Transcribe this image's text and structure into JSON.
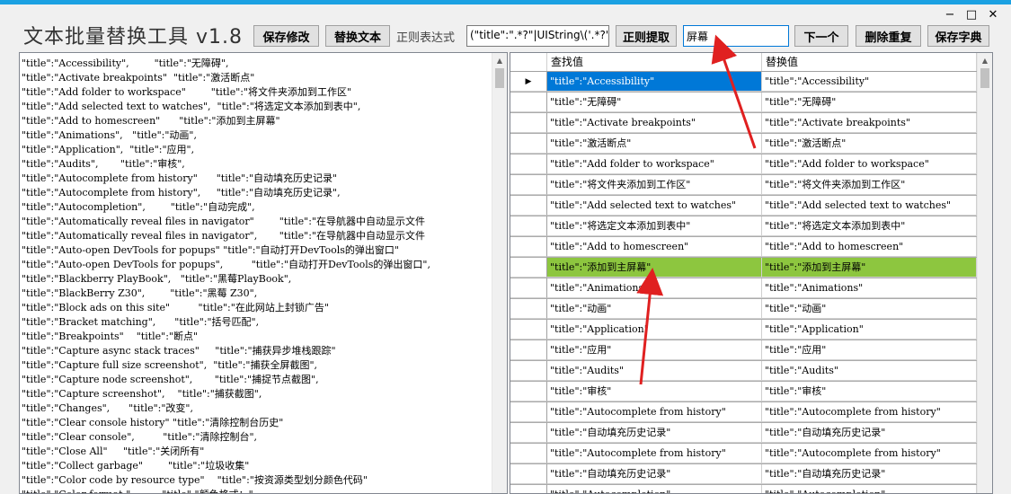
{
  "app": {
    "title": "文本批量替换工具 v1.8",
    "window_controls": [
      "−",
      "□",
      "✕"
    ]
  },
  "toolbar": {
    "save_changes_label": "保存修改",
    "replace_text_label": "替换文本",
    "regex_label": "正则表达式",
    "regex_value": "(\"title\":\".*?\"|UIString\\('.*?'\\))",
    "regex_extract_label": "正则提取",
    "search_value": "屏幕",
    "next_label": "下一个",
    "dedupe_label": "删除重复",
    "save_dict_label": "保存字典"
  },
  "left_lines": [
    "\"title\":\"Accessibility\",        \"title\":\"无障碍\",",
    "\"title\":\"Activate breakpoints\"  \"title\":\"激活断点\"",
    "\"title\":\"Add folder to workspace\"        \"title\":\"将文件夹添加到工作区\"",
    "\"title\":\"Add selected text to watches\",  \"title\":\"将选定文本添加到表中\",",
    "\"title\":\"Add to homescreen\"      \"title\":\"添加到主屏幕\"",
    "\"title\":\"Animations\",   \"title\":\"动画\",",
    "\"title\":\"Application\",  \"title\":\"应用\",",
    "\"title\":\"Audits\",       \"title\":\"审核\",",
    "\"title\":\"Autocomplete from history\"      \"title\":\"自动填充历史记录\"",
    "\"title\":\"Autocomplete from history\",     \"title\":\"自动填充历史记录\",",
    "\"title\":\"Autocompletion\",        \"title\":\"自动完成\",",
    "\"title\":\"Automatically reveal files in navigator\"        \"title\":\"在导航器中自动显示文件",
    "\"title\":\"Automatically reveal files in navigator\",       \"title\":\"在导航器中自动显示文件",
    "\"title\":\"Auto-open DevTools for popups\" \"title\":\"自动打开DevTools的弹出窗口\"",
    "\"title\":\"Auto-open DevTools for popups\",         \"title\":\"自动打开DevTools的弹出窗口\",",
    "\"title\":\"Blackberry PlayBook\",   \"title\":\"黑莓PlayBook\",",
    "\"title\":\"BlackBerry Z30\",        \"title\":\"黑莓 Z30\",",
    "\"title\":\"Block ads on this site\"         \"title\":\"在此网站上封锁广告\"",
    "\"title\":\"Bracket matching\",      \"title\":\"括号匹配\",",
    "\"title\":\"Breakpoints\"    \"title\":\"断点\"",
    "\"title\":\"Capture async stack traces\"     \"title\":\"捕获异步堆栈跟踪\"",
    "\"title\":\"Capture full size screenshot\",  \"title\":\"捕获全屏截图\",",
    "\"title\":\"Capture node screenshot\",       \"title\":\"捕捉节点截图\",",
    "\"title\":\"Capture screenshot\",    \"title\":\"捕获截图\",",
    "\"title\":\"Changes\",      \"title\":\"改变\",",
    "\"title\":\"Clear console history\" \"title\":\"清除控制台历史\"",
    "\"title\":\"Clear console\",         \"title\":\"清除控制台\",",
    "\"title\":\"Close All\"     \"title\":\"关闭所有\"",
    "\"title\":\"Collect garbage\"        \"title\":\"垃圾收集\"",
    "\"title\":\"Color code by resource type\"    \"title\":\"按资源类型划分颜色代码\"",
    "\"title\":\"Color format:\"          \"title\":\"颜色格式：\""
  ],
  "grid": {
    "col_find": "查找值",
    "col_replace": "替换值",
    "row_pointer": "▶",
    "rows": [
      {
        "find": "\"title\":\"Accessibility\"",
        "replace": "\"title\":\"Accessibility\""
      },
      {
        "find": "\"title\":\"无障碍\"",
        "replace": "\"title\":\"无障碍\""
      },
      {
        "find": "\"title\":\"Activate breakpoints\"",
        "replace": "\"title\":\"Activate breakpoints\""
      },
      {
        "find": "\"title\":\"激活断点\"",
        "replace": "\"title\":\"激活断点\""
      },
      {
        "find": "\"title\":\"Add folder to workspace\"",
        "replace": "\"title\":\"Add folder to workspace\""
      },
      {
        "find": "\"title\":\"将文件夹添加到工作区\"",
        "replace": "\"title\":\"将文件夹添加到工作区\""
      },
      {
        "find": "\"title\":\"Add selected text to watches\"",
        "replace": "\"title\":\"Add selected text to watches\""
      },
      {
        "find": "\"title\":\"将选定文本添加到表中\"",
        "replace": "\"title\":\"将选定文本添加到表中\""
      },
      {
        "find": "\"title\":\"Add to homescreen\"",
        "replace": "\"title\":\"Add to homescreen\""
      },
      {
        "find": "\"title\":\"添加到主屏幕\"",
        "replace": "\"title\":\"添加到主屏幕\""
      },
      {
        "find": "\"title\":\"Animations\"",
        "replace": "\"title\":\"Animations\""
      },
      {
        "find": "\"title\":\"动画\"",
        "replace": "\"title\":\"动画\""
      },
      {
        "find": "\"title\":\"Application\"",
        "replace": "\"title\":\"Application\""
      },
      {
        "find": "\"title\":\"应用\"",
        "replace": "\"title\":\"应用\""
      },
      {
        "find": "\"title\":\"Audits\"",
        "replace": "\"title\":\"Audits\""
      },
      {
        "find": "\"title\":\"审核\"",
        "replace": "\"title\":\"审核\""
      },
      {
        "find": "\"title\":\"Autocomplete from history\"",
        "replace": "\"title\":\"Autocomplete from history\""
      },
      {
        "find": "\"title\":\"自动填充历史记录\"",
        "replace": "\"title\":\"自动填充历史记录\""
      },
      {
        "find": "\"title\":\"Autocomplete from history\"",
        "replace": "\"title\":\"Autocomplete from history\""
      },
      {
        "find": "\"title\":\"自动填充历史记录\"",
        "replace": "\"title\":\"自动填充历史记录\""
      },
      {
        "find": "\"title\":\"Autocompletion\"",
        "replace": "\"title\":\"Autocompletion\""
      }
    ]
  },
  "colors": {
    "selected_row": "#0078d7",
    "highlight_row": "#8dc63f",
    "annotation_arrow": "#e02020"
  }
}
